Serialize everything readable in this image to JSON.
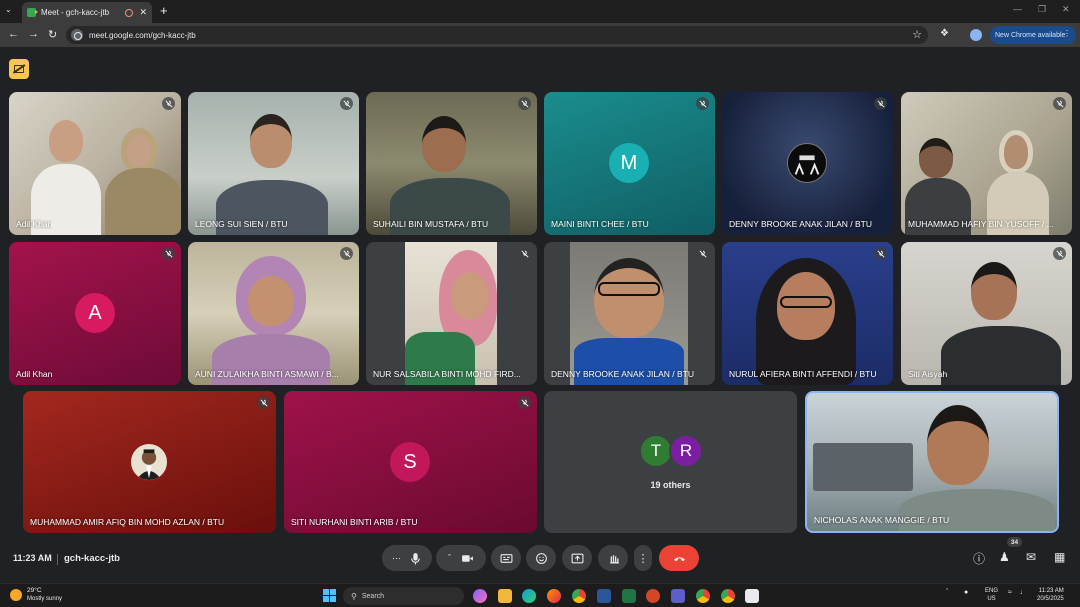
{
  "browser": {
    "tab_title": "Meet - gch-kacc-jtb",
    "url": "meet.google.com/gch-kacc-jtb",
    "new_chrome_label": "New Chrome available"
  },
  "tiles": [
    {
      "name": "Adil Khan",
      "muted": true
    },
    {
      "name": "LEONG SUI SIEN / BTU",
      "muted": true
    },
    {
      "name": "SUHAILI BIN MUSTAFA / BTU",
      "muted": true
    },
    {
      "name": "MAINI BINTI CHEE / BTU",
      "muted": true,
      "avatar_letter": "M",
      "avatar_color": "#12939a"
    },
    {
      "name": "DENNY BROOKE ANAK JILAN / BTU",
      "muted": true
    },
    {
      "name": "MUHAMMAD HAFIY BIN YUSOFF / ...",
      "muted": true
    },
    {
      "name": "Adil Khan",
      "muted": true,
      "avatar_letter": "A",
      "avatar_color": "#d81b60"
    },
    {
      "name": "AUNI ZULAIKHA BINTI ASMAWI / B...",
      "muted": true
    },
    {
      "name": "NUR SALSABILA BINTI MOHD FIRD...",
      "muted": true
    },
    {
      "name": "DENNY BROOKE ANAK JILAN / BTU",
      "muted": true
    },
    {
      "name": "NURUL AFIERA BINTI AFFENDI / BTU",
      "muted": true
    },
    {
      "name": "Siti Aisyah",
      "muted": true
    },
    {
      "name": "MUHAMMAD AMIR AFIQ BIN MOHD AZLAN / BTU",
      "muted": true
    },
    {
      "name": "SITI NURHANI BINTI ARIB / BTU",
      "muted": true,
      "avatar_letter": "S",
      "avatar_color": "#c2185b"
    },
    {
      "name": "NICHOLAS ANAK MANGGIE / BTU",
      "muted": false
    }
  ],
  "others": {
    "letters": [
      "T",
      "R"
    ],
    "colors": [
      "#2e7d32",
      "#7b1fa2"
    ],
    "label": "19 others"
  },
  "bottom_bar": {
    "time": "11:23 AM",
    "meeting_code": "gch-kacc-jtb",
    "participant_count": "34"
  },
  "taskbar": {
    "temp": "29°C",
    "weather": "Mostly sunny",
    "search_label": "Search",
    "lang_line1": "ENG",
    "lang_line2": "US",
    "time": "11:23 AM",
    "date": "20/5/2025"
  }
}
